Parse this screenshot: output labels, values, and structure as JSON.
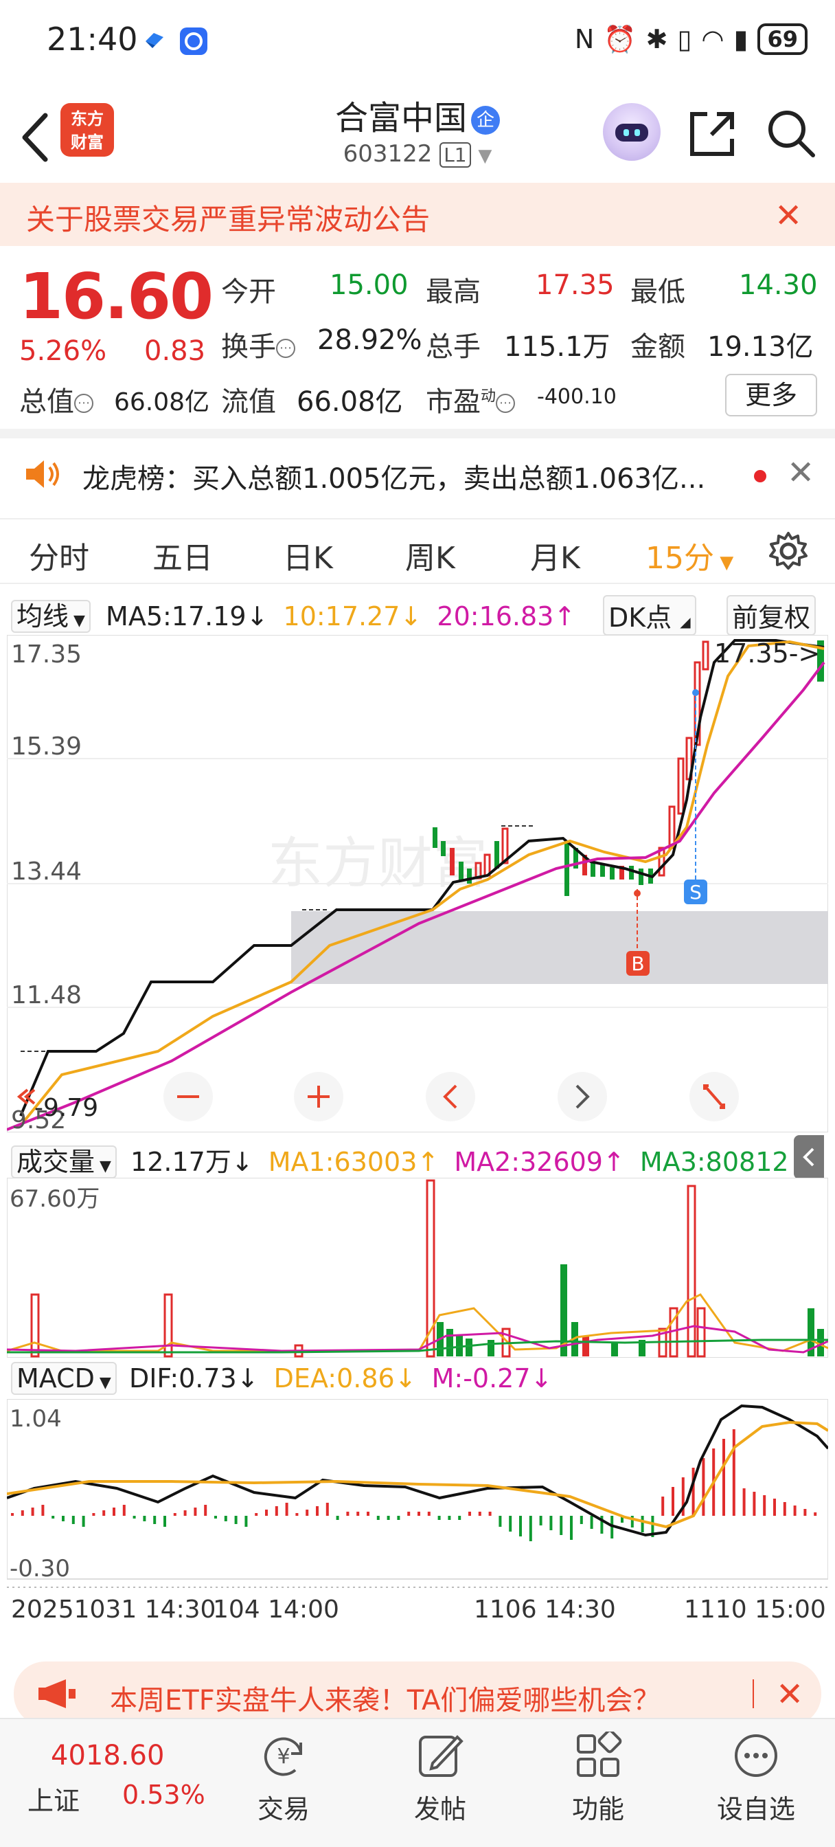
{
  "status_bar": {
    "time": "21:40",
    "battery": "69"
  },
  "header": {
    "logo_line1": "东方",
    "logo_line2": "财富",
    "stock_name": "合富中国",
    "enterprise_badge": "企",
    "stock_code": "603122",
    "level": "L1"
  },
  "notice": {
    "text": "关于股票交易严重异常波动公告"
  },
  "quote": {
    "price": "16.60",
    "change_pct": "5.26%",
    "change": "0.83",
    "open_label": "今开",
    "open": "15.00",
    "high_label": "最高",
    "high": "17.35",
    "low_label": "最低",
    "low": "14.30",
    "turnover_label": "换手",
    "turnover": "28.92%",
    "volume_label": "总手",
    "volume": "115.1万",
    "amount_label": "金额",
    "amount": "19.13亿",
    "mktcap_label": "总值",
    "mktcap": "66.08亿",
    "float_label": "流值",
    "float_cap": "66.08亿",
    "pe_label": "市盈",
    "pe_sup": "动",
    "pe": "-400.10",
    "more_label": "更多"
  },
  "dragon_tiger": {
    "text": "龙虎榜：买入总额1.005亿元，卖出总额1.063亿..."
  },
  "tabs": [
    {
      "label": "分时"
    },
    {
      "label": "五日"
    },
    {
      "label": "日K"
    },
    {
      "label": "周K"
    },
    {
      "label": "月K"
    },
    {
      "label": "15分"
    }
  ],
  "ma_row": {
    "selector": "均线",
    "ma5": "MA5:17.19↓",
    "ma10": "10:17.27↓",
    "ma20": "20:16.83↑",
    "dk": "DK点",
    "adjust": "前复权"
  },
  "price_axis": [
    "17.35",
    "15.39",
    "13.44",
    "11.48",
    "9.52"
  ],
  "price_markers": {
    "high_tag": "17.35->",
    "low_tag": "-9.79",
    "buy": "B",
    "sell": "S"
  },
  "volume_row": {
    "selector": "成交量",
    "value": "12.17万↓",
    "ma1": "MA1:63003↑",
    "ma2": "MA2:32609↑",
    "ma3": "MA3:80812↑",
    "axis_max": "67.60万"
  },
  "macd_row": {
    "selector": "MACD",
    "dif": "DIF:0.73↓",
    "dea": "DEA:0.86↓",
    "m": "M:-0.27↓",
    "axis_max": "1.04",
    "axis_min": "-0.30"
  },
  "time_axis": [
    "20251031 14:30",
    "104 14:00",
    "1106 14:30",
    "1110 15:00"
  ],
  "banner": {
    "text": "本周ETF实盘牛人来袭！TA们偏爱哪些机会？"
  },
  "bottom_nav": {
    "index_value": "4018.60",
    "index_name": "上证",
    "index_pct": "0.53%",
    "items": [
      {
        "label": "交易"
      },
      {
        "label": "发帖"
      },
      {
        "label": "功能"
      },
      {
        "label": "设自选"
      }
    ]
  },
  "colors": {
    "up": "#e02c2c",
    "down": "#0f9a30",
    "accent": "#e8452c",
    "ma5": "#111111",
    "ma10": "#f0a81a",
    "ma20": "#d01aa4",
    "selected_tab": "#f39a1e"
  }
}
